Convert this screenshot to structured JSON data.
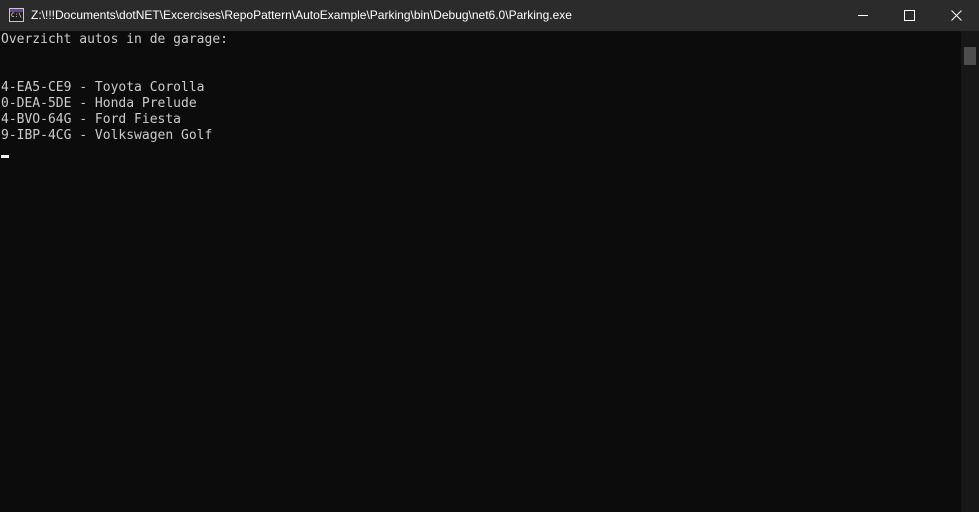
{
  "window": {
    "title": "Z:\\!!!Documents\\dotNET\\Excercises\\RepoPattern\\AutoExample\\Parking\\bin\\Debug\\net6.0\\Parking.exe",
    "icon": "console-app-icon",
    "icon_text": "C:\\"
  },
  "controls": {
    "minimize": "minimize-icon",
    "maximize": "maximize-icon",
    "close": "✕"
  },
  "console": {
    "heading": "Overzicht autos in de garage:",
    "lines": [
      "4-EA5-CE9 - Toyota Corolla",
      "0-DEA-5DE - Honda Prelude",
      "4-BVO-64G - Ford Fiesta",
      "9-IBP-4CG - Volkswagen Golf"
    ]
  }
}
